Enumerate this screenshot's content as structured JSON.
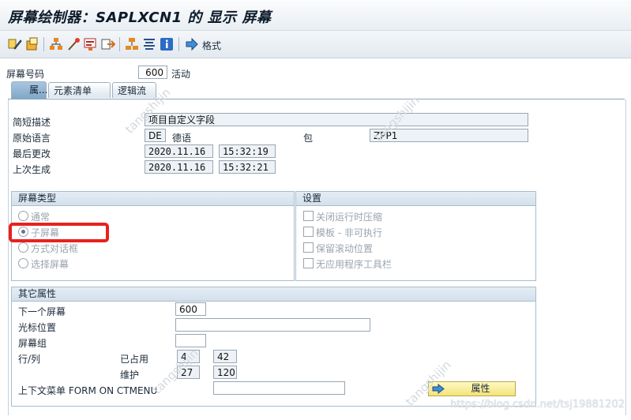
{
  "window": {
    "title": "屏幕绘制器：SAPLXCN1 的 显示 屏幕"
  },
  "toolbar": {
    "icons": [
      "toggle-edit-icon",
      "other-object-icon",
      "hierarchy-icon",
      "wand-icon",
      "layout-editor-icon",
      "element-list-icon",
      "flow-logic-icon",
      "align-icon",
      "info-icon",
      "arrow-right-icon"
    ],
    "format_label": "格式"
  },
  "screen_number": {
    "label": "屏幕号码",
    "value": "600",
    "status": "活动"
  },
  "tabs": [
    {
      "label": "属..."
    },
    {
      "label": "元素清单"
    },
    {
      "label": "逻辑流"
    }
  ],
  "attributes": {
    "short_desc": {
      "label": "简短描述",
      "value": "项目自定义字段"
    },
    "orig_lang": {
      "label": "原始语言",
      "code": "DE",
      "name": "德语"
    },
    "package": {
      "label": "包",
      "value": "ZPP1"
    },
    "last_changed": {
      "label": "最后更改",
      "date": "2020.11.16",
      "time": "15:32:19"
    },
    "last_generated": {
      "label": "上次生成",
      "date": "2020.11.16",
      "time": "15:32:21"
    }
  },
  "screen_type": {
    "title": "屏幕类型",
    "options": [
      {
        "label": "通常",
        "selected": false
      },
      {
        "label": "子屏幕",
        "selected": true
      },
      {
        "label": "方式对话框",
        "selected": false
      },
      {
        "label": "选择屏幕",
        "selected": false
      }
    ]
  },
  "settings": {
    "title": "设置",
    "options": [
      {
        "label": "关闭运行时压缩",
        "checked": false
      },
      {
        "label": "模板 - 非可执行",
        "checked": false
      },
      {
        "label": "保留滚动位置",
        "checked": false
      },
      {
        "label": "无应用程序工具栏",
        "checked": false
      }
    ]
  },
  "other_attrs": {
    "title": "其它属性",
    "next_screen": {
      "label": "下一个屏幕",
      "value": "600"
    },
    "cursor_pos": {
      "label": "光标位置",
      "value": ""
    },
    "screen_group": {
      "label": "屏幕组",
      "value": ""
    },
    "row_col": {
      "label": "行/列",
      "used_label": "已占用",
      "used_row": "4",
      "used_col": "42",
      "maint_label": "维护",
      "maint_row": "27",
      "maint_col": "120"
    },
    "context_menu": {
      "label": "上下文菜单 FORM ON CTMENU",
      "value": ""
    },
    "attr_button": "属性"
  },
  "watermark": {
    "text": "tangshijin",
    "credit": "https://blog.csdn.net/tsj19881202"
  },
  "colors": {
    "highlight": "#e8211d",
    "tab_active": "#8fb3d3",
    "button": "#f3e37a"
  }
}
